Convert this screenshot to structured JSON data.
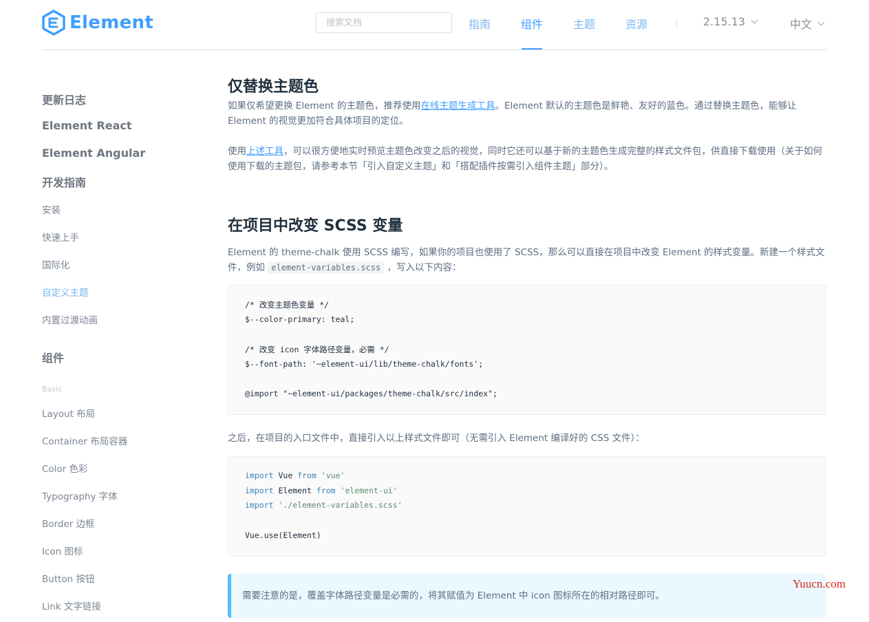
{
  "header": {
    "logo_text": "Element",
    "search_placeholder": "搜索文档",
    "nav": [
      {
        "label": "指南"
      },
      {
        "label": "组件"
      },
      {
        "label": "主题"
      },
      {
        "label": "资源"
      }
    ],
    "active_nav": "组件",
    "version": "2.15.13",
    "language": "中文",
    "accent_color": "#409eff"
  },
  "sidebar": {
    "items": [
      {
        "label": "更新日志",
        "kind": "group"
      },
      {
        "label": "Element React",
        "kind": "group"
      },
      {
        "label": "Element Angular",
        "kind": "group"
      },
      {
        "label": "开发指南",
        "kind": "group"
      },
      {
        "label": "安装",
        "kind": "link"
      },
      {
        "label": "快速上手",
        "kind": "link"
      },
      {
        "label": "国际化",
        "kind": "link"
      },
      {
        "label": "自定义主题",
        "kind": "link-active"
      },
      {
        "label": "内置过渡动画",
        "kind": "link"
      },
      {
        "label": "组件",
        "kind": "group"
      },
      {
        "label": "Basic",
        "kind": "category"
      },
      {
        "label": "Layout 布局",
        "kind": "link"
      },
      {
        "label": "Container 布局容器",
        "kind": "link"
      },
      {
        "label": "Color 色彩",
        "kind": "link"
      },
      {
        "label": "Typography 字体",
        "kind": "link"
      },
      {
        "label": "Border 边框",
        "kind": "link"
      },
      {
        "label": "Icon 图标",
        "kind": "link"
      },
      {
        "label": "Button 按钮",
        "kind": "link"
      },
      {
        "label": "Link 文字链接",
        "kind": "link"
      }
    ]
  },
  "content": {
    "section1": {
      "title": "仅替换主题色",
      "p1_before": "如果仅希望更换 Element 的主题色，推荐使用",
      "p1_link": "在线主题生成工具",
      "p1_after": "。Element 默认的主题色是鲜艳、友好的蓝色。通过替换主题色，能够让 Element 的视觉更加符合具体项目的定位。",
      "p2_before": "使用",
      "p2_link": "上述工具",
      "p2_after": "，可以很方便地实时预览主题色改变之后的视觉，同时它还可以基于新的主题色生成完整的样式文件包，供直接下载使用（关于如何使用下载的主题包，请参考本节「引入自定义主题」和「搭配插件按需引入组件主题」部分）。"
    },
    "section2": {
      "title": "在项目中改变 SCSS 变量",
      "p1_before": "Element 的 theme-chalk 使用 SCSS 编写，如果你的项目也使用了 SCSS，那么可以直接在项目中改变 Element 的样式变量。新建一个样式文件，例如 ",
      "p1_code": "element-variables.scss",
      "p1_after": " ，写入以下内容：",
      "code1": [
        "/* 改变主题色变量 */",
        "$--color-primary: teal;",
        "/* 改变 icon 字体路径变量，必需 */",
        "$--font-path: '~element-ui/lib/theme-chalk/fonts';",
        "@import \"~element-ui/packages/theme-chalk/src/index\";"
      ],
      "p2": "之后，在项目的入口文件中，直接引入以上样式文件即可（无需引入 Element 编译好的 CSS 文件）：",
      "code2": {
        "kw_import": "import",
        "kw_from": "from",
        "line1_name": "Vue",
        "line1_src": "'vue'",
        "line2_name": "Element",
        "line2_src": "'element-ui'",
        "line3_src": "'./element-variables.scss'",
        "line4": "Vue.use(Element)"
      },
      "tip": "需要注意的是，覆盖字体路径变量是必需的，将其赋值为 Element 中 icon 图标所在的相对路径即可。"
    }
  },
  "watermark": "Yuucn.com"
}
